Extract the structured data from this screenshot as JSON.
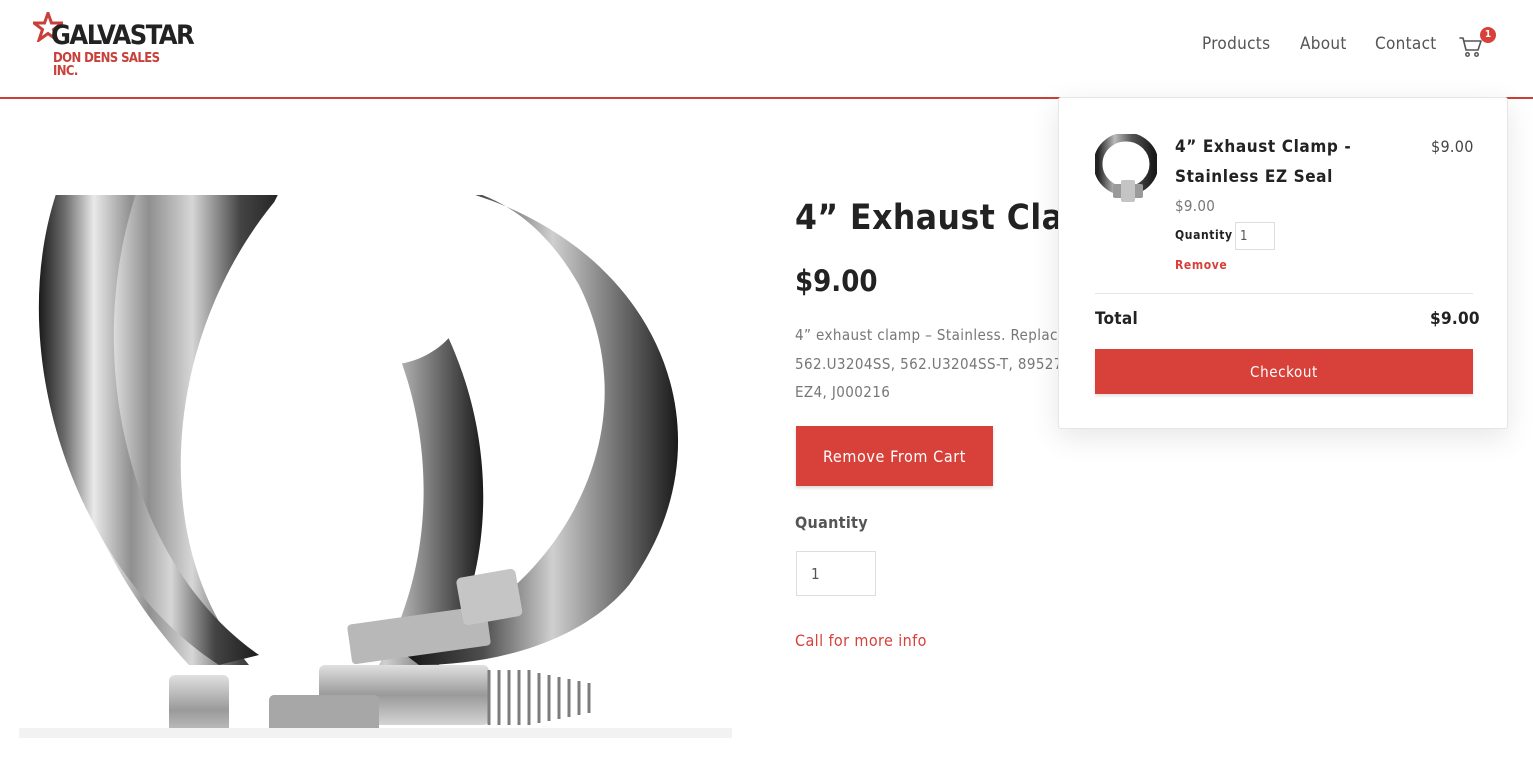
{
  "brand": {
    "logo_top": "GALVASTAR",
    "logo_bottom": "DON DENS SALES INC.",
    "logo_color": "#c9403a"
  },
  "nav": {
    "items": [
      {
        "label": "Products"
      },
      {
        "label": "About"
      },
      {
        "label": "Contact"
      }
    ],
    "cart_icon": "shopping-cart-icon",
    "cart_count": "1"
  },
  "product": {
    "title": "4” Exhaust Clamp",
    "price": "$9.00",
    "description_lines": [
      "4” exhaust clamp – Stainless. Replac",
      "562.U3204SS, 562.U3204SS-T, 89527",
      "EZ4, J000216"
    ],
    "remove_button": "Remove From Cart",
    "quantity_label": "Quantity",
    "quantity_value": "1",
    "call_info": "Call for more info"
  },
  "cart": {
    "item": {
      "name": "4” Exhaust Clamp - Stainless EZ Seal",
      "line_price": "$9.00",
      "unit_price": "$9.00",
      "quantity_label": "Quantity",
      "quantity_value": "1",
      "remove_label": "Remove"
    },
    "total_label": "Total",
    "total_value": "$9.00",
    "checkout_label": "Checkout"
  },
  "colors": {
    "accent": "#d8403a",
    "text": "#222222",
    "muted": "#777777"
  }
}
